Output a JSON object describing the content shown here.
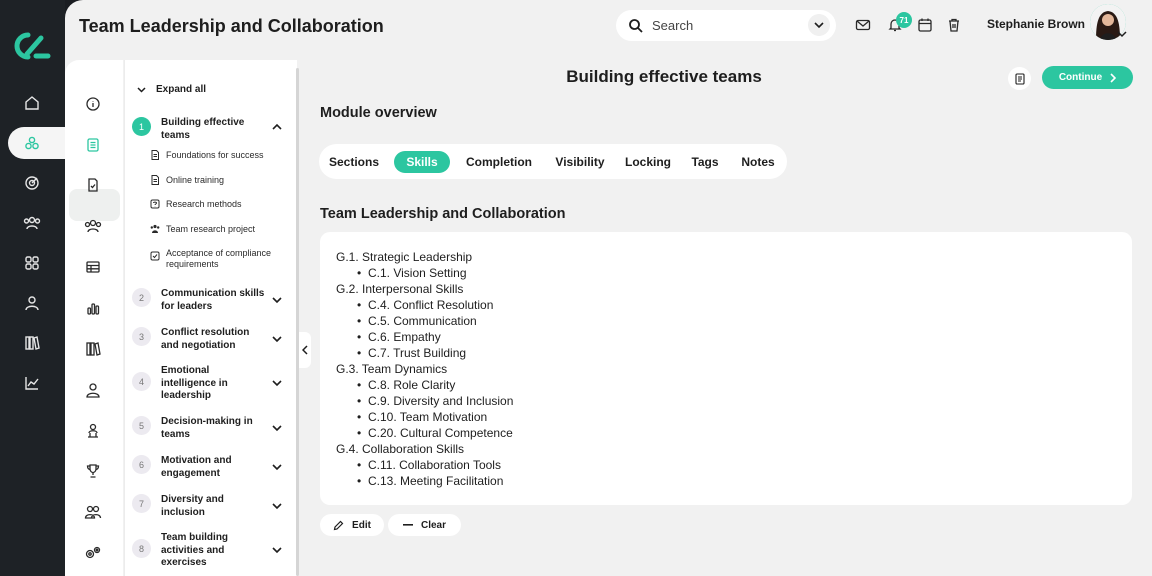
{
  "app": {
    "title": "Team Leadership and Collaboration"
  },
  "search": {
    "placeholder": "Search"
  },
  "notifications": {
    "count": "71"
  },
  "user": {
    "name": "Stephanie Brown"
  },
  "rail": {
    "icons": [
      "home-icon",
      "modules-icon",
      "target-icon",
      "users-icon",
      "apps-icon",
      "profile-icon",
      "library-icon",
      "analytics-icon"
    ]
  },
  "nav2": {
    "icons": [
      "info-icon",
      "lesson-icon",
      "task-icon",
      "group-icon",
      "table-icon",
      "chart-icon",
      "books-icon",
      "person-icon",
      "mentor-icon",
      "trophy-icon",
      "pair-icon",
      "settings-icon"
    ]
  },
  "tree": {
    "expand_label": "Expand all",
    "modules": [
      {
        "num": "1",
        "title": "Building effective teams",
        "active": true
      },
      {
        "num": "2",
        "title": "Communication skills for leaders"
      },
      {
        "num": "3",
        "title": "Conflict resolution and negotiation"
      },
      {
        "num": "4",
        "title": "Emotional intelligence in leadership"
      },
      {
        "num": "5",
        "title": "Decision-making in teams"
      },
      {
        "num": "6",
        "title": "Motivation and engagement"
      },
      {
        "num": "7",
        "title": "Diversity and inclusion"
      },
      {
        "num": "8",
        "title": "Team building activities and exercises"
      }
    ],
    "lessons": [
      {
        "title": "Foundations for success",
        "icon": "document-icon"
      },
      {
        "title": "Online training",
        "icon": "document-icon"
      },
      {
        "title": "Research methods",
        "icon": "quiz-icon"
      },
      {
        "title": "Team research project",
        "icon": "team-icon"
      },
      {
        "title": "Acceptance of compliance requirements",
        "icon": "checkbox-icon"
      }
    ]
  },
  "content": {
    "page_title": "Building effective teams",
    "continue_label": "Continue",
    "overview_heading": "Module overview",
    "tabs": [
      "Sections",
      "Skills",
      "Completion",
      "Visibility",
      "Locking",
      "Tags",
      "Notes"
    ],
    "active_tab": "Skills",
    "section_title": "Team Leadership and Collaboration",
    "skills": [
      {
        "group": "G.1. Strategic Leadership",
        "items": [
          "C.1. Vision Setting"
        ]
      },
      {
        "group": "G.2. Interpersonal Skills",
        "items": [
          "C.4. Conflict Resolution",
          "C.5. Communication",
          "C.6. Empathy",
          "C.7. Trust Building"
        ]
      },
      {
        "group": "G.3. Team Dynamics",
        "items": [
          "C.8. Role Clarity",
          "C.9. Diversity and Inclusion",
          "C.10. Team Motivation",
          "C.20. Cultural Competence"
        ]
      },
      {
        "group": "G.4. Collaboration Skills",
        "items": [
          "C.11. Collaboration Tools",
          "C.13. Meeting Facilitation"
        ]
      }
    ],
    "edit_label": "Edit",
    "clear_label": "Clear"
  },
  "colors": {
    "accent": "#2cc6a0",
    "rail": "#1e2226",
    "surface": "#f1f1f1"
  }
}
